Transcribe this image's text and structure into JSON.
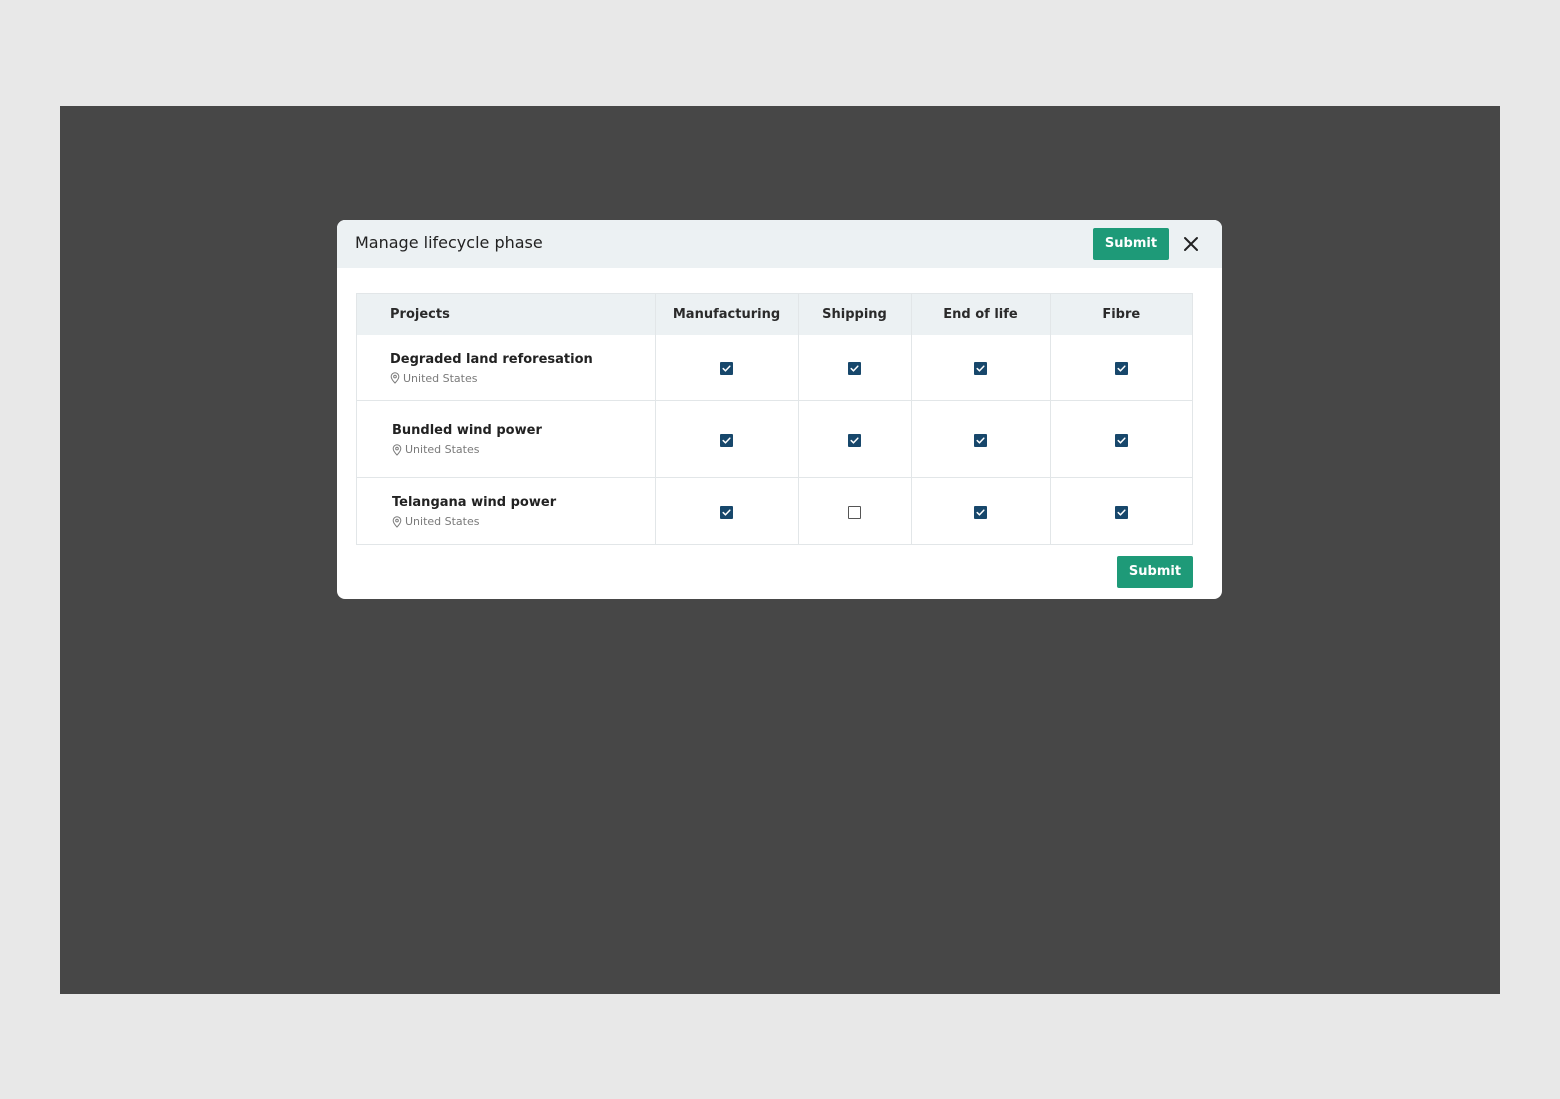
{
  "modal": {
    "title": "Manage lifecycle phase",
    "submit_label": "Submit",
    "bottom_submit_label": "Submit",
    "close_icon": "close-icon"
  },
  "table": {
    "columns": [
      "Projects",
      "Manufacturing",
      "Shipping",
      "End of life",
      "Fibre"
    ],
    "rows": [
      {
        "name": "Degraded land reforesation",
        "location": "United States",
        "manufacturing": true,
        "shipping": true,
        "end_of_life": true,
        "fibre": true
      },
      {
        "name": "Bundled wind power",
        "location": "United States",
        "manufacturing": true,
        "shipping": true,
        "end_of_life": true,
        "fibre": true
      },
      {
        "name": "Telangana wind power",
        "location": "United States",
        "manufacturing": true,
        "shipping": false,
        "end_of_life": true,
        "fibre": true
      }
    ]
  },
  "colors": {
    "accent": "#1e9a78",
    "checkbox": "#17476b",
    "header_bg": "#ecf1f3",
    "overlay": "#474747"
  }
}
